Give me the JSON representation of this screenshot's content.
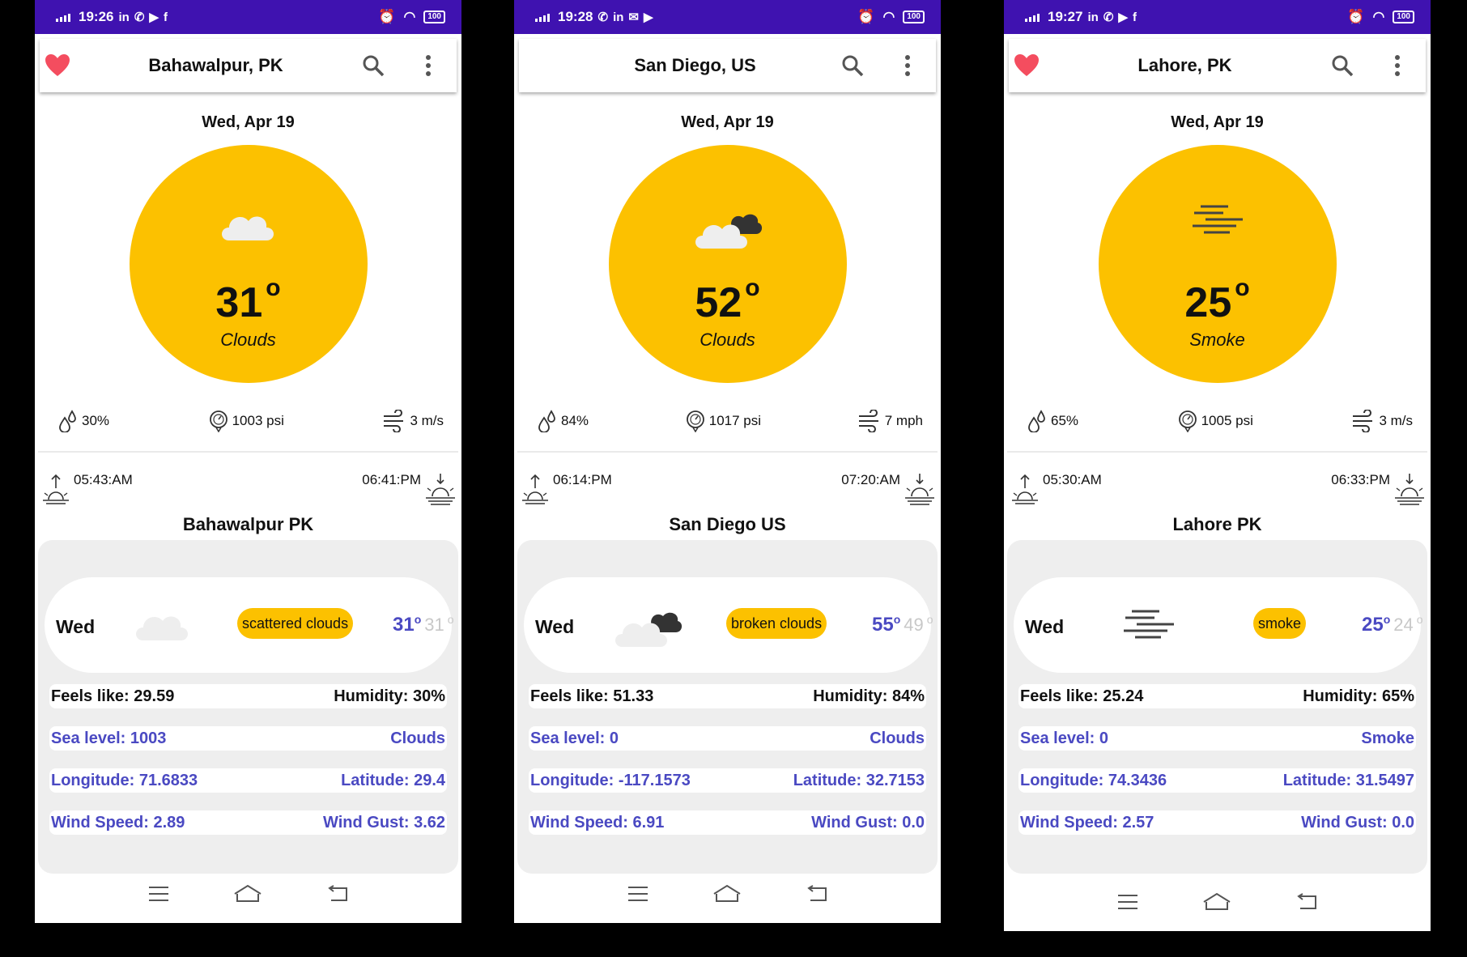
{
  "phones": [
    {
      "status_time": "19:26",
      "favorite": true,
      "title": "Bahawalpur,  PK",
      "date": "Wed, Apr 19",
      "temp": "31",
      "temp_unit": "o",
      "condition": "Clouds",
      "icon": "cloud-icon",
      "humidity": "30%",
      "pressure": "1003 psi",
      "wind": "3 m/s",
      "sunrise": "05:43:AM",
      "sunset": "06:41:PM",
      "place": "Bahawalpur PK",
      "forecast": {
        "day": "Wed",
        "desc": "scattered clouds",
        "hi": "31",
        "lo": "31",
        "deg": "o"
      },
      "feels_like": "Feels like: 29.59",
      "humidity_label": "Humidity: 30%",
      "sea_level": "Sea level: 1003",
      "main": "Clouds",
      "longitude": "Longitude: 71.6833",
      "latitude": "Latitude: 29.4",
      "wind_speed": "Wind Speed: 2.89",
      "wind_gust": "Wind Gust: 3.62"
    },
    {
      "status_time": "19:28",
      "favorite": false,
      "title": "San Diego,  US",
      "date": "Wed, Apr 19",
      "temp": "52",
      "temp_unit": "o",
      "condition": "Clouds",
      "icon": "broken-clouds-icon",
      "humidity": "84%",
      "pressure": "1017 psi",
      "wind": "7 mph",
      "sunrise": "06:14:PM",
      "sunset": "07:20:AM",
      "place": "San Diego US",
      "forecast": {
        "day": "Wed",
        "desc": "broken clouds",
        "hi": "55",
        "lo": "49",
        "deg": "o"
      },
      "feels_like": "Feels like: 51.33",
      "humidity_label": "Humidity: 84%",
      "sea_level": "Sea level: 0",
      "main": "Clouds",
      "longitude": "Longitude: -117.1573",
      "latitude": "Latitude: 32.7153",
      "wind_speed": "Wind Speed: 6.91",
      "wind_gust": "Wind Gust: 0.0"
    },
    {
      "status_time": "19:27",
      "favorite": true,
      "title": "Lahore,  PK",
      "date": "Wed, Apr 19",
      "temp": "25",
      "temp_unit": "o",
      "condition": "Smoke",
      "icon": "smoke-icon",
      "humidity": "65%",
      "pressure": "1005 psi",
      "wind": "3 m/s",
      "sunrise": "05:30:AM",
      "sunset": "06:33:PM",
      "place": "Lahore PK",
      "forecast": {
        "day": "Wed",
        "desc": "smoke",
        "hi": "25",
        "lo": "24",
        "deg": "o"
      },
      "feels_like": "Feels like: 25.24",
      "humidity_label": "Humidity: 65%",
      "sea_level": "Sea level: 0",
      "main": "Smoke",
      "longitude": "Longitude: 74.3436",
      "latitude": "Latitude: 31.5497",
      "wind_speed": "Wind Speed: 2.57",
      "wind_gust": "Wind Gust: 0.0"
    }
  ],
  "colors": {
    "status_bar": "#3f12b0",
    "sun_circle": "#fcc100",
    "accent_text": "#4a49c2",
    "heart": "#f44d5f"
  }
}
